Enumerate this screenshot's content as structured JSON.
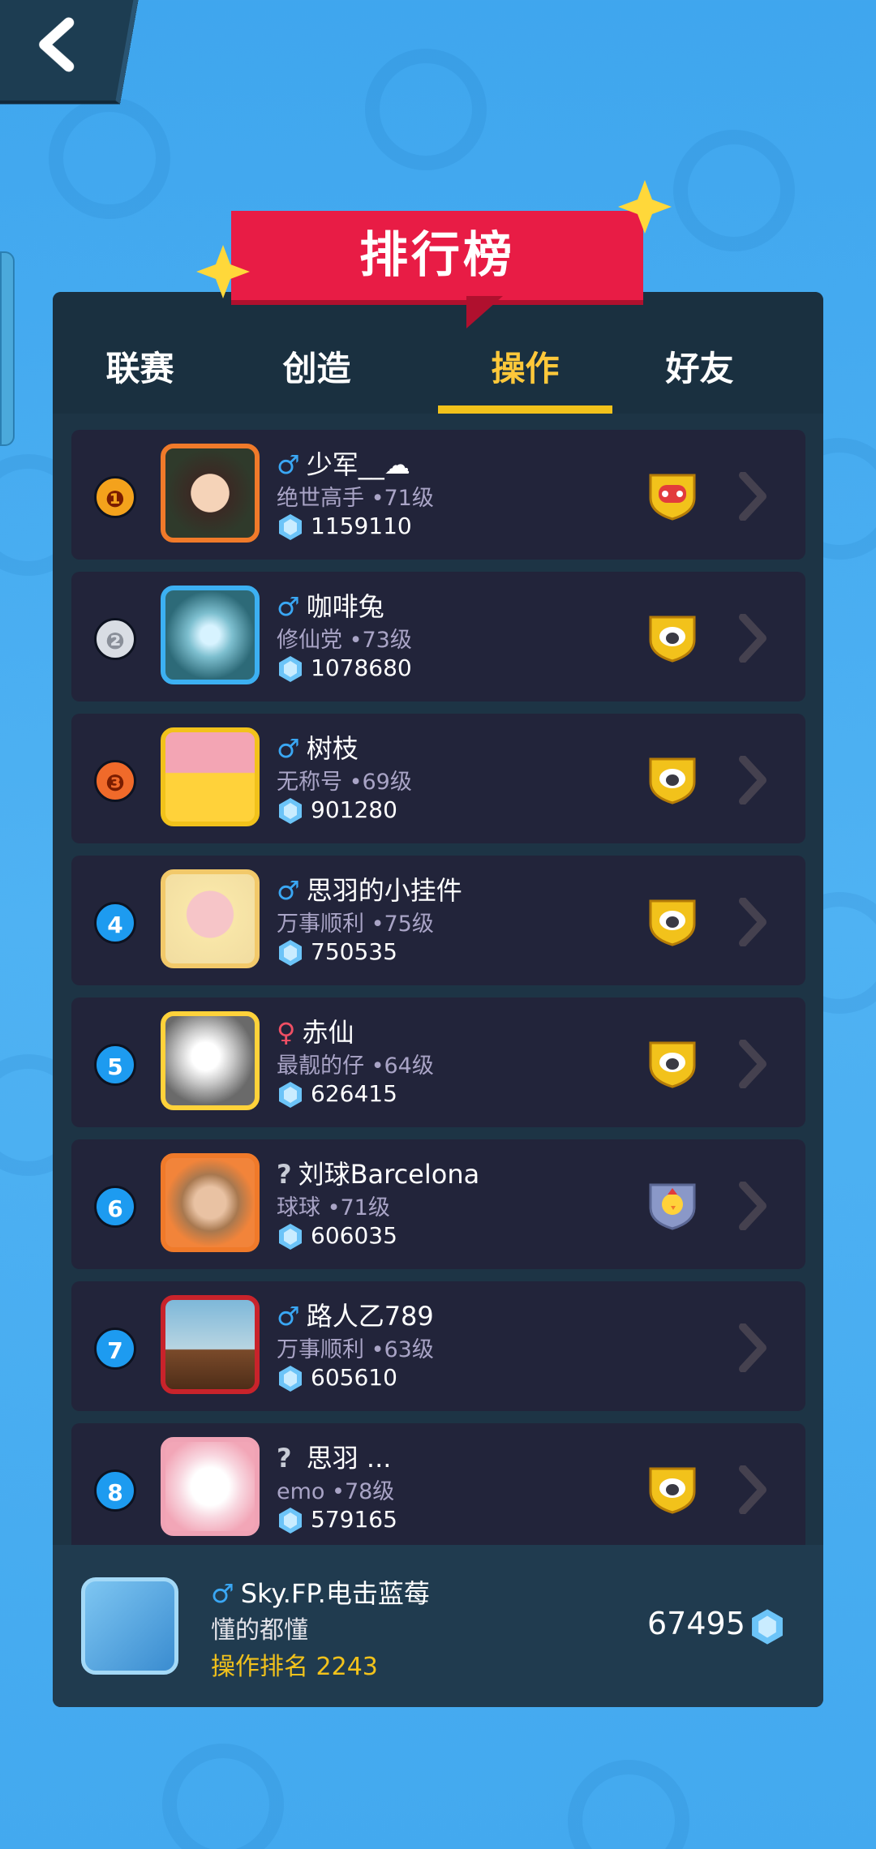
{
  "header": {
    "back_icon": "chevron-left-icon",
    "title": "排行榜"
  },
  "tabs": [
    {
      "label": "联赛",
      "active": false
    },
    {
      "label": "创造",
      "active": false
    },
    {
      "label": "操作",
      "active": true
    },
    {
      "label": "好友",
      "active": false
    }
  ],
  "leaderboard": [
    {
      "rank": "❶",
      "gender": "♂",
      "name": "少军__☁",
      "title": "绝世高手 •71级",
      "score": "1159110",
      "badge": "gamepad-shield-icon"
    },
    {
      "rank": "❷",
      "gender": "♂",
      "name": "咖啡兔",
      "title": "修仙党 •73级",
      "score": "1078680",
      "badge": "sheep-shield-icon"
    },
    {
      "rank": "❸",
      "gender": "♂",
      "name": "树枝",
      "title": "无称号 •69级",
      "score": "901280",
      "badge": "sheep-shield-icon"
    },
    {
      "rank": "4",
      "gender": "♂",
      "name": "思羽的小挂件",
      "title": "万事顺利 •75级",
      "score": "750535",
      "badge": "sheep-shield-icon"
    },
    {
      "rank": "5",
      "gender": "♀",
      "name": "赤仙",
      "title": "最靓的仔 •64级",
      "score": "626415",
      "badge": "sheep-shield-icon"
    },
    {
      "rank": "6",
      "gender": "?",
      "name": "刘球Barcelona",
      "title": "球球 •71级",
      "score": "606035",
      "badge": "chicken-shield-icon"
    },
    {
      "rank": "7",
      "gender": "♂",
      "name": "路人乙789",
      "title": "万事顺利 •63级",
      "score": "605610",
      "badge": ""
    },
    {
      "rank": "8",
      "gender": "?",
      "name": " 思羽 ...",
      "title": "emo •78级",
      "score": "579165",
      "badge": "sheep-shield-icon"
    }
  ],
  "me": {
    "gender": "♂",
    "name": "Sky.FP.电击蓝莓",
    "title": "懂的都懂",
    "rank_text": "操作排名 2243",
    "score": "67495"
  },
  "colors": {
    "accent_yellow": "#f2c21b",
    "banner_red": "#e81c45",
    "male_blue": "#3aa7f4",
    "female_red": "#f04f64"
  }
}
